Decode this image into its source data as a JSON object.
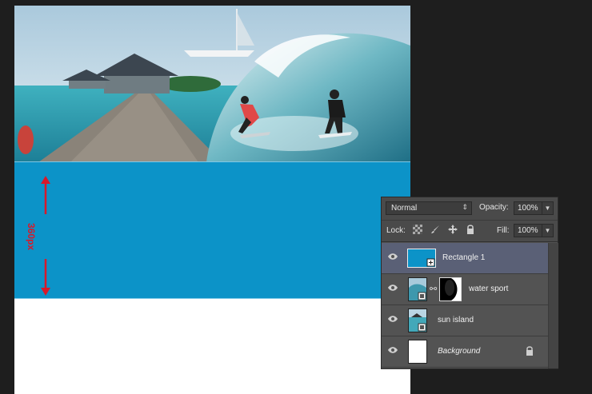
{
  "canvas": {
    "height_annotation": "360px"
  },
  "colors": {
    "rectangle_fill": "#0c93c8",
    "annotation": "#d8192a",
    "panel_bg": "#535353",
    "selected_layer": "#5a6076"
  },
  "layers_panel": {
    "blend_mode": "Normal",
    "opacity_label": "Opacity:",
    "opacity_value": "100%",
    "lock_label": "Lock:",
    "fill_label": "Fill:",
    "fill_value": "100%",
    "lock_icons": [
      "transparency-lock-icon",
      "brush-lock-icon",
      "move-lock-icon",
      "padlock-icon"
    ],
    "layers": [
      {
        "name": "Rectangle 1",
        "selected": true,
        "icon": "shape-layer"
      },
      {
        "name": "water sport",
        "selected": false,
        "icon": "masked-smart-object"
      },
      {
        "name": "sun island",
        "selected": false,
        "icon": "smart-object"
      },
      {
        "name": "Background",
        "selected": false,
        "icon": "background-locked"
      }
    ]
  }
}
